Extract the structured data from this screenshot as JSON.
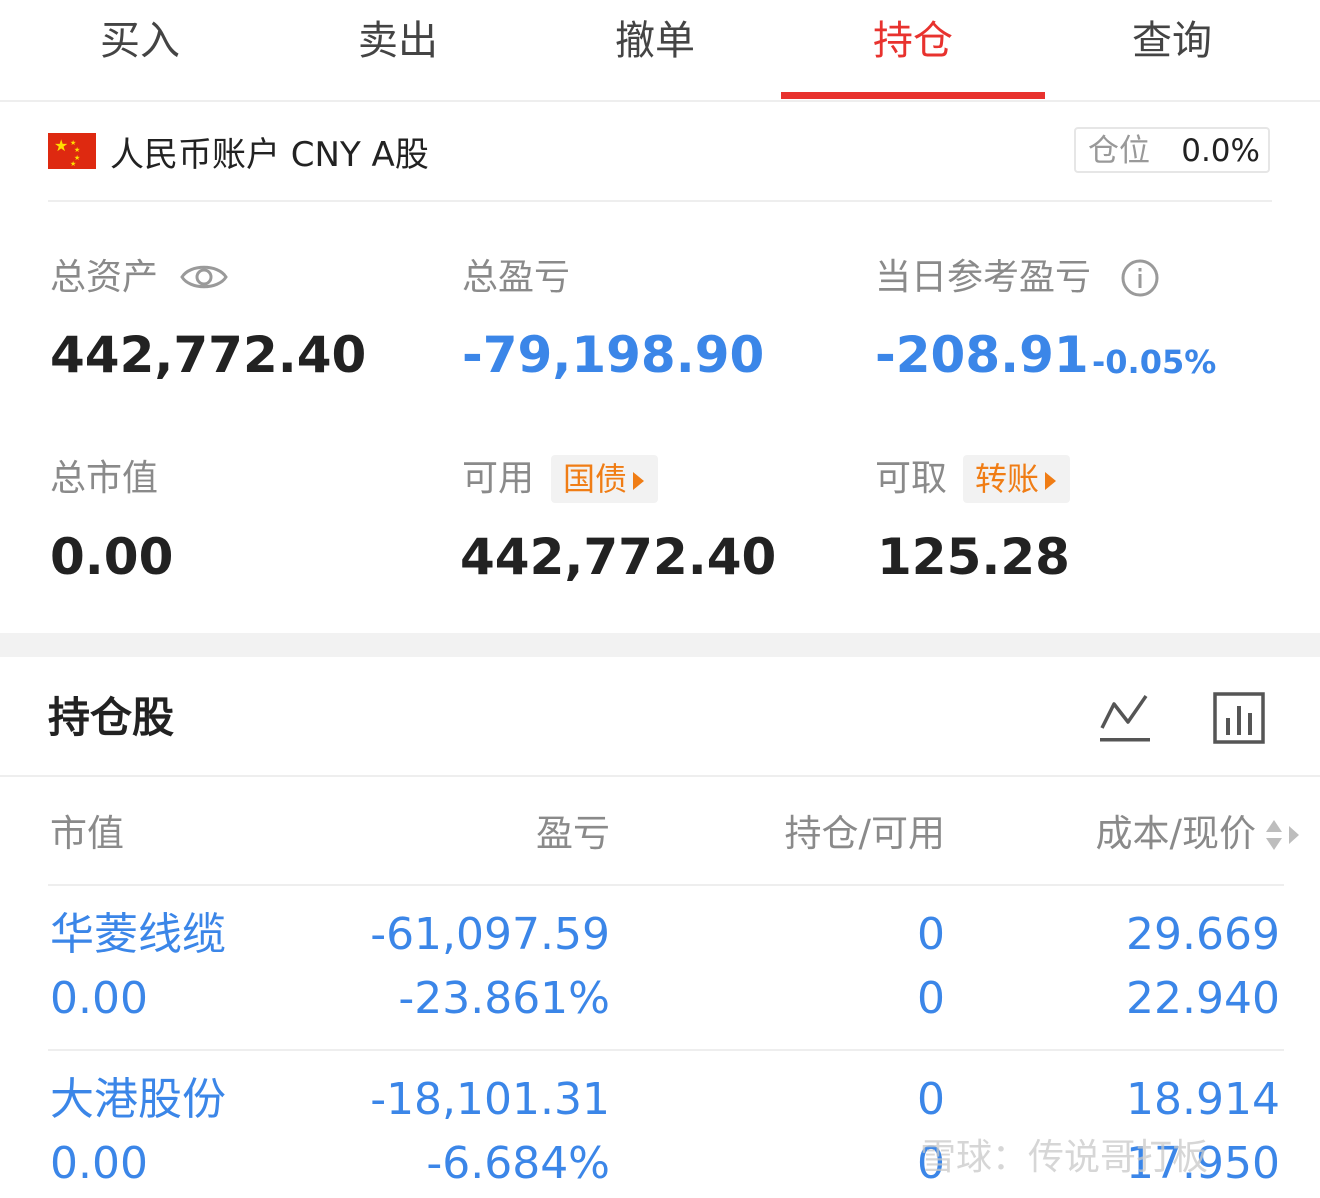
{
  "tabs": [
    {
      "label": "买入",
      "active": false
    },
    {
      "label": "卖出",
      "active": false
    },
    {
      "label": "撤单",
      "active": false
    },
    {
      "label": "持仓",
      "active": true
    },
    {
      "label": "查询",
      "active": false
    }
  ],
  "colors": {
    "accent": "#e8322e",
    "loss": "#3b86e8",
    "tag_orange": "#f07d15"
  },
  "account": {
    "flag_icon": "china-flag-icon",
    "label": "人民币账户 CNY A股",
    "position_label": "仓位",
    "position_value": "0.0%"
  },
  "summary": {
    "total_assets_label": "总资产",
    "total_assets_value": "442,772.40",
    "total_pnl_label": "总盈亏",
    "total_pnl_value": "-79,198.90",
    "daily_pnl_label": "当日参考盈亏",
    "daily_pnl_value": "-208.91",
    "daily_pnl_pct": "-0.05%",
    "market_value_label": "总市值",
    "market_value_value": "0.00",
    "available_label": "可用",
    "available_tag": "国债",
    "available_value": "442,772.40",
    "withdrawable_label": "可取",
    "withdrawable_tag": "转账",
    "withdrawable_value": "125.28"
  },
  "holdings": {
    "title": "持仓股",
    "columns": [
      "市值",
      "盈亏",
      "持仓/可用",
      "成本/现价"
    ],
    "rows": [
      {
        "name": "华菱线缆",
        "market_value": "0.00",
        "pnl": "-61,097.59",
        "pnl_pct": "-23.861%",
        "position": "0",
        "available": "0",
        "cost": "29.669",
        "price": "22.940"
      },
      {
        "name": "大港股份",
        "market_value": "0.00",
        "pnl": "-18,101.31",
        "pnl_pct": "-6.684%",
        "position": "0",
        "available": "0",
        "cost": "18.914",
        "price": "17.950"
      }
    ]
  },
  "watermark": "雪球：传说哥打板"
}
